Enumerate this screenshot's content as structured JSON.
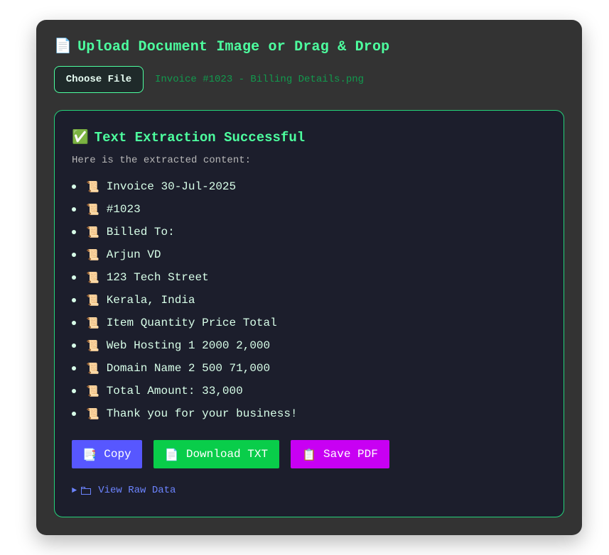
{
  "upload": {
    "title_icon": "📄",
    "title": "Upload Document Image or Drag & Drop",
    "choose_file_label": "Choose File",
    "file_name": "Invoice #1023 - Billing Details.png"
  },
  "result": {
    "title_icon": "✅",
    "title": "Text Extraction Successful",
    "subtitle": "Here is the extracted content:",
    "line_icon": "📜",
    "lines": [
      "Invoice 30-Jul-2025",
      "#1023",
      "Billed To:",
      "Arjun VD",
      "123 Tech Street",
      "Kerala, India",
      "Item Quantity Price Total",
      "Web Hosting 1 2000 2,000",
      "Domain Name 2 500 71,000",
      "Total Amount: 33,000",
      "Thank you for your business!"
    ]
  },
  "actions": {
    "copy": {
      "icon": "📑",
      "label": "Copy"
    },
    "download": {
      "icon": "📄",
      "label": "Download TXT"
    },
    "pdf": {
      "icon": "📋",
      "label": "Save PDF"
    }
  },
  "raw_data": {
    "label": "View Raw Data"
  },
  "colors": {
    "panel_bg": "#333333",
    "accent_green": "#4dff9f",
    "result_bg": "#1c1e2c",
    "result_border": "#24d37a",
    "copy_button": "#5757ff",
    "download_button": "#09cd4a",
    "pdf_button": "#c800f3",
    "link_blue": "#6c84ff"
  }
}
